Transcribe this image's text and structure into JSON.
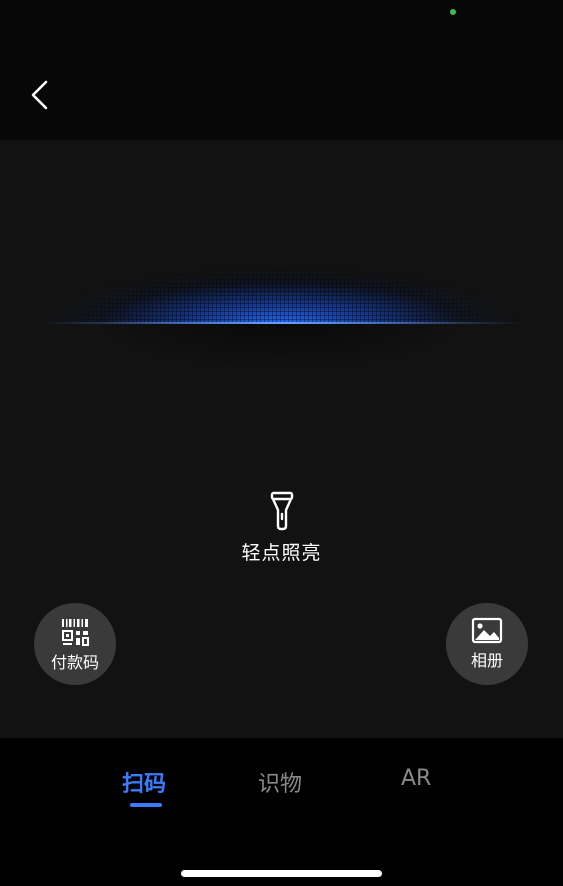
{
  "icons": {
    "back": "chevron-left-icon",
    "torch": "flashlight-icon",
    "pay_code": "qr-code-icon",
    "album": "image-icon"
  },
  "colors": {
    "accent": "#3b7cff",
    "inactive_tab": "#8a8a8a",
    "button_bg": "#3a3a3a",
    "status_dot": "#3fbf4a"
  },
  "torch": {
    "label": "轻点照亮"
  },
  "buttons": {
    "pay_code": "付款码",
    "album": "相册"
  },
  "tabs": [
    {
      "label": "扫码",
      "selected": true
    },
    {
      "label": "识物",
      "selected": false
    },
    {
      "label": "AR",
      "selected": false
    }
  ]
}
